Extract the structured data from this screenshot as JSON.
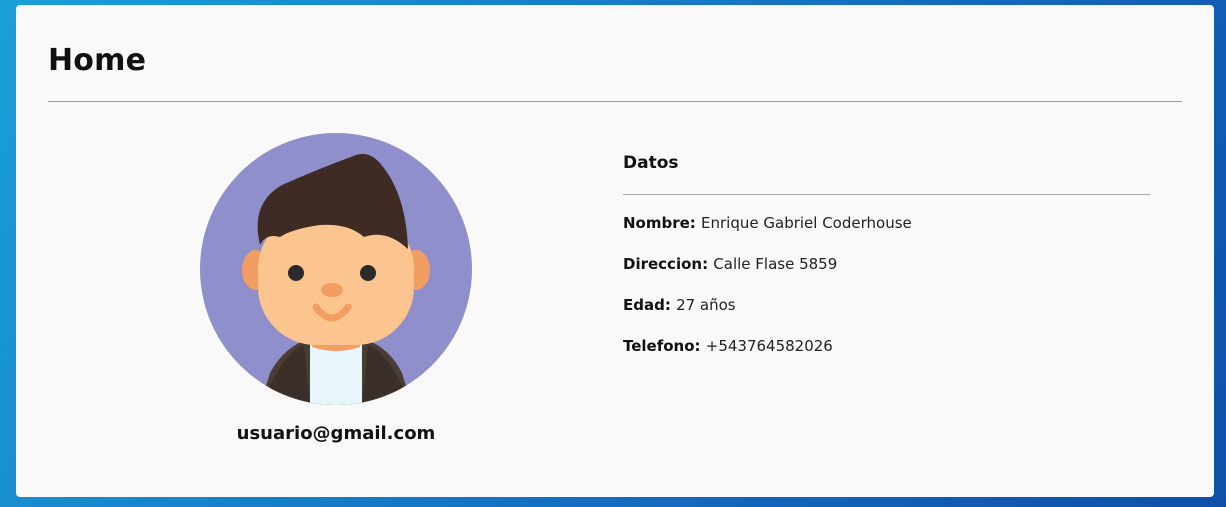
{
  "header": {
    "title": "Home"
  },
  "profile": {
    "avatar_icon": "user-avatar-illustration",
    "email": "usuario@gmail.com"
  },
  "datos": {
    "title": "Datos",
    "fields": [
      {
        "label": "Nombre:",
        "value": "Enrique Gabriel Coderhouse"
      },
      {
        "label": "Direccion:",
        "value": "Calle Flase 5859"
      },
      {
        "label": "Edad:",
        "value": "27 años"
      },
      {
        "label": "Telefono:",
        "value": "+543764582026"
      }
    ]
  },
  "colors": {
    "background_start": "#1a9fd8",
    "background_end": "#0f4fa8",
    "card": "#f9f9f9",
    "avatar_circle": "#8f8fcb",
    "hair": "#3e2b23",
    "skin": "#fcc48e",
    "jacket": "#4b3d36",
    "shirt": "#e6f6fa"
  }
}
